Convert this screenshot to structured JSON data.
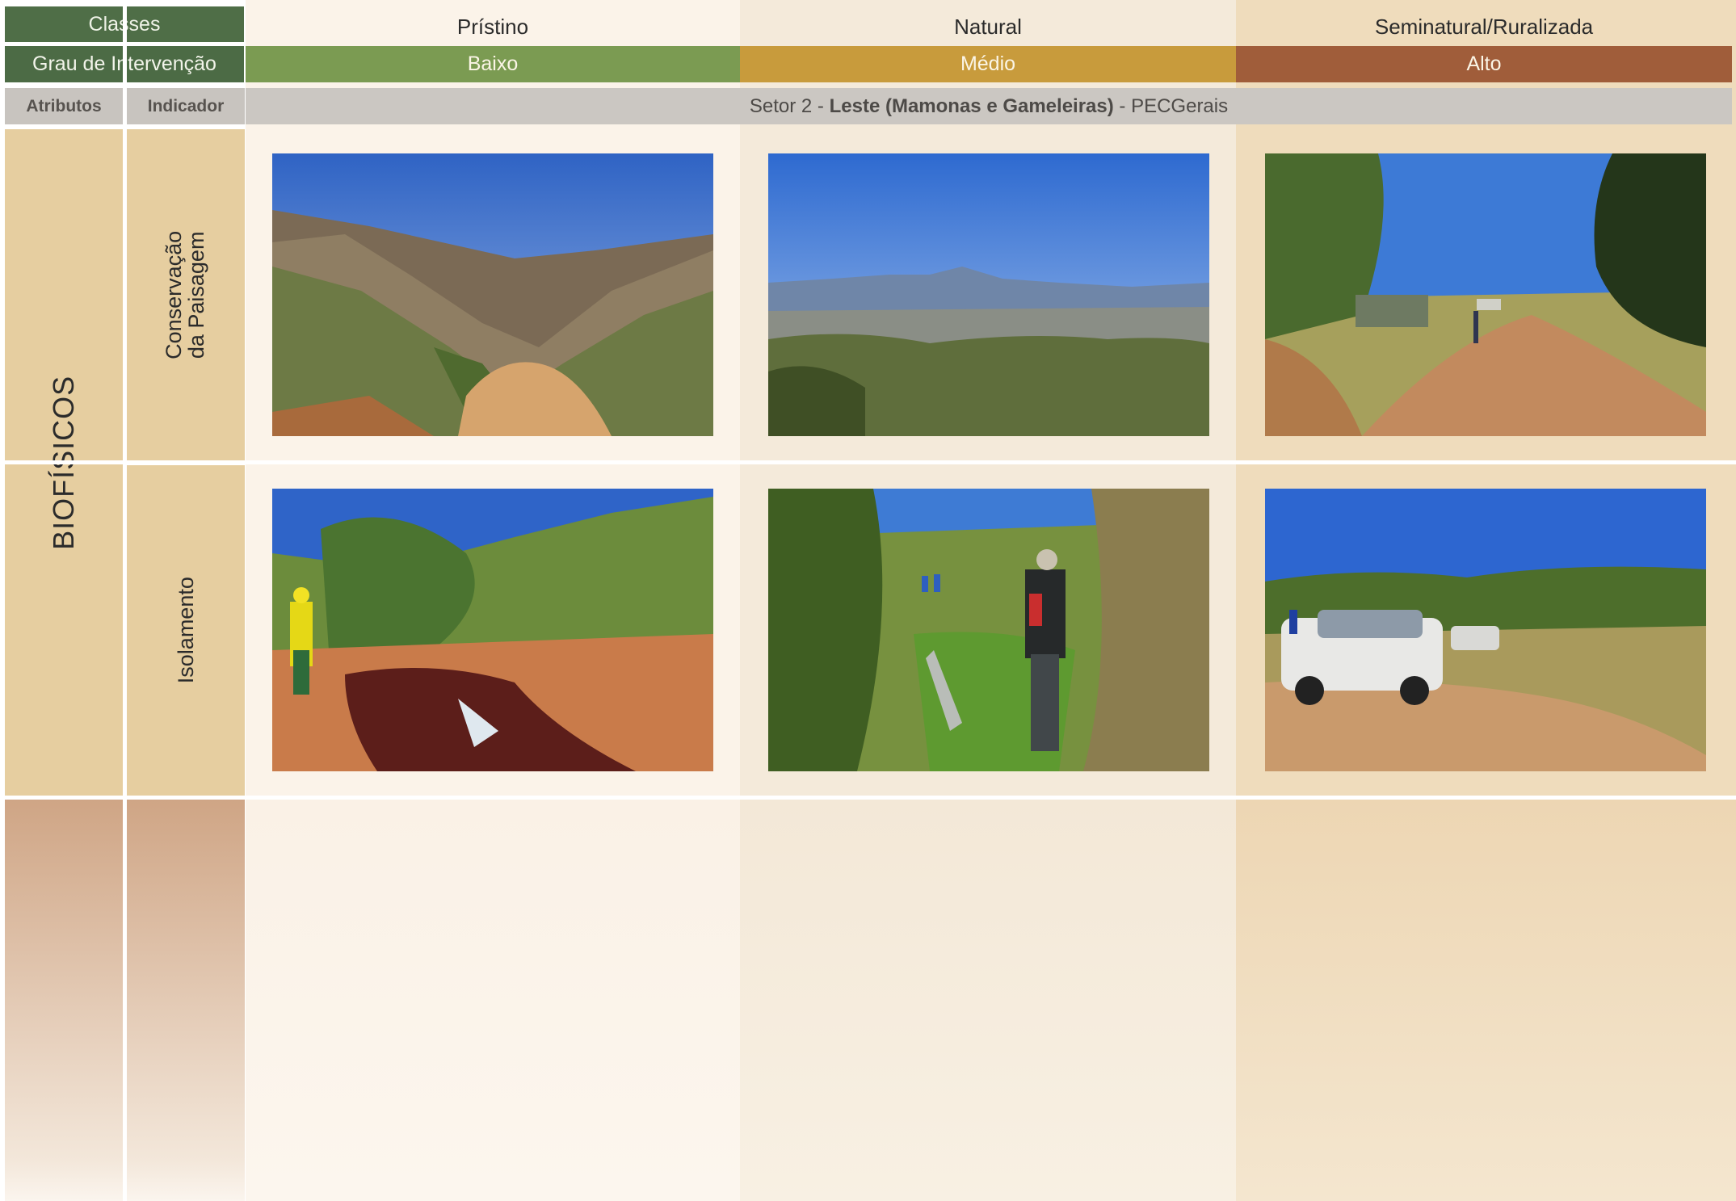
{
  "header": {
    "classes_label": "Classes",
    "grau_label": "Grau de Intervenção",
    "attributes_label": "Atributos",
    "indicator_label": "Indicador",
    "columns": [
      {
        "class": "Prístino",
        "grau": "Baixo",
        "grau_color": "#7b9b52",
        "bg": "#fbf3e9"
      },
      {
        "class": "Natural",
        "grau": "Médio",
        "grau_color": "#c89b3c",
        "bg": "#f4eada"
      },
      {
        "class": "Seminatural/Ruralizada",
        "grau": "Alto",
        "grau_color": "#a05d3a",
        "bg": "#efdcbc"
      }
    ]
  },
  "setor": {
    "prefix": "Setor 2 - ",
    "bold": "Leste (Mamonas e Gameleiras)",
    "suffix": " - PECGerais"
  },
  "rows": {
    "attribute": "BIOFÍSICOS",
    "indicators": [
      {
        "label": "Conservação\nda Paisagem"
      },
      {
        "label": "Isolamento"
      }
    ]
  },
  "photos": [
    {
      "icon": "canyon-landscape-photo"
    },
    {
      "icon": "mountain-horizon-photo"
    },
    {
      "icon": "trail-with-sign-photo"
    },
    {
      "icon": "rocky-stream-photo"
    },
    {
      "icon": "dense-vegetation-hikers-photo"
    },
    {
      "icon": "vehicles-dirt-road-photo"
    }
  ],
  "colors": {
    "header_green": "#4f6e47",
    "attribute_tan": "#e6cea0",
    "bottom_brown": "#cfa585"
  }
}
